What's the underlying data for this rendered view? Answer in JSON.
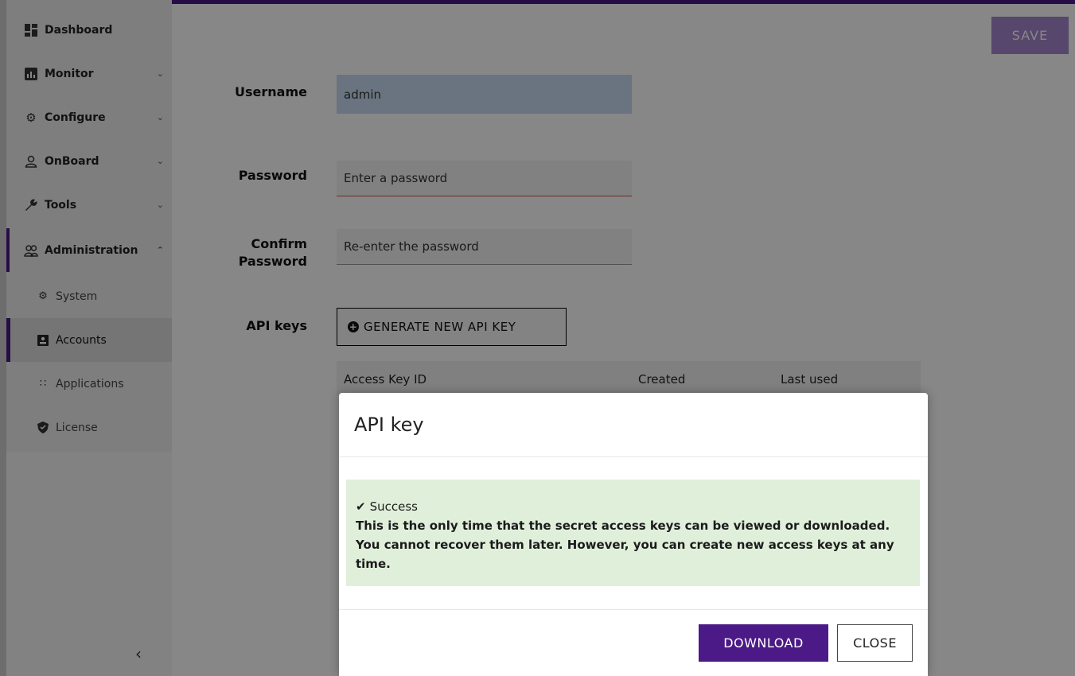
{
  "sidebar": {
    "items": [
      {
        "label": "Dashboard",
        "icon": "dashboard-icon",
        "has_chevron": false
      },
      {
        "label": "Monitor",
        "icon": "monitor-icon",
        "has_chevron": true
      },
      {
        "label": "Configure",
        "icon": "gear-icon",
        "has_chevron": true
      },
      {
        "label": "OnBoard",
        "icon": "user-icon",
        "has_chevron": true
      },
      {
        "label": "Tools",
        "icon": "wrench-icon",
        "has_chevron": true
      },
      {
        "label": "Administration",
        "icon": "users-icon",
        "has_chevron": true,
        "expanded": true
      }
    ],
    "subitems": [
      {
        "label": "System",
        "icon": "gear-icon"
      },
      {
        "label": "Accounts",
        "icon": "account-icon",
        "selected": true
      },
      {
        "label": "Applications",
        "icon": "grid-icon"
      },
      {
        "label": "License",
        "icon": "shield-icon"
      }
    ],
    "collapse_icon": "chevron-left-icon"
  },
  "toolbar": {
    "save_label": "SAVE"
  },
  "form": {
    "username_label": "Username",
    "username_value": "admin",
    "password_label": "Password",
    "password_placeholder": "Enter a password",
    "confirm_label_1": "Confirm",
    "confirm_label_2": "Password",
    "confirm_placeholder": "Re-enter the password",
    "api_keys_label": "API keys",
    "generate_button": "GENERATE NEW API KEY"
  },
  "api_table": {
    "columns": [
      "Access Key ID",
      "Created",
      "Last used"
    ]
  },
  "modal": {
    "title": "API key",
    "alert_title": "Success",
    "alert_message": "This is the only time that the secret access keys can be viewed or downloaded. You cannot recover them later. However, you can create new access keys at any time.",
    "download_label": "DOWNLOAD",
    "close_label": "CLOSE"
  },
  "colors": {
    "accent": "#4b1a86",
    "success_bg": "#e0efda"
  }
}
